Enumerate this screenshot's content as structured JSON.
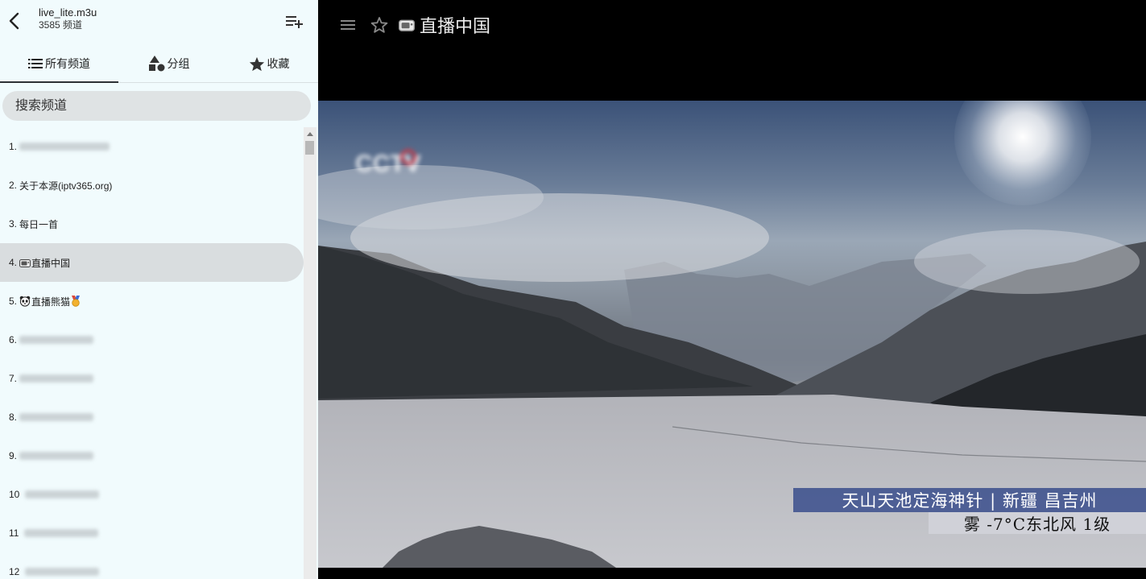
{
  "sidebar": {
    "header": {
      "file_name": "live_lite.m3u",
      "channel_count": "3585 频道"
    },
    "tabs": [
      {
        "label": "所有频道",
        "icon": "list-icon"
      },
      {
        "label": "分组",
        "icon": "shapes-icon"
      },
      {
        "label": "收藏",
        "icon": "star-filled-icon"
      }
    ],
    "search": {
      "placeholder": "搜索频道"
    },
    "channels": [
      {
        "num": "1.",
        "label": "",
        "blurred": true
      },
      {
        "num": "2.",
        "label": "关于本源(iptv365.org)"
      },
      {
        "num": "3.",
        "label": "每日一首"
      },
      {
        "num": "4.",
        "label": "直播中国",
        "icon": "tv-emoji-icon",
        "active": true
      },
      {
        "num": "5.",
        "label": "直播熊猫",
        "icon": "panda-emoji-icon",
        "trailing_icon": "medal-emoji-icon"
      },
      {
        "num": "6.",
        "label": "",
        "blurred": true
      },
      {
        "num": "7.",
        "label": "",
        "blurred": true
      },
      {
        "num": "8.",
        "label": "",
        "blurred": true
      },
      {
        "num": "9.",
        "label": "",
        "blurred": true
      },
      {
        "num": "10",
        "label": "",
        "blurred": true
      },
      {
        "num": "11",
        "label": "",
        "blurred": true
      },
      {
        "num": "12",
        "label": "",
        "blurred": true
      }
    ]
  },
  "player": {
    "title": "直播中国",
    "title_icon": "tv-emoji-icon",
    "video": {
      "logo": "CCTV",
      "caption_line1": "天山天池定海神针 | 新疆 昌吉州",
      "caption_line2": "雾 -7°C东北风 1级"
    }
  },
  "colors": {
    "sidebar_bg": "#f1fbfd",
    "active_item_bg": "#d9dddf",
    "search_bg": "#dfe3e4",
    "player_bg": "#000000",
    "caption_bar": "#3a4e8c"
  }
}
